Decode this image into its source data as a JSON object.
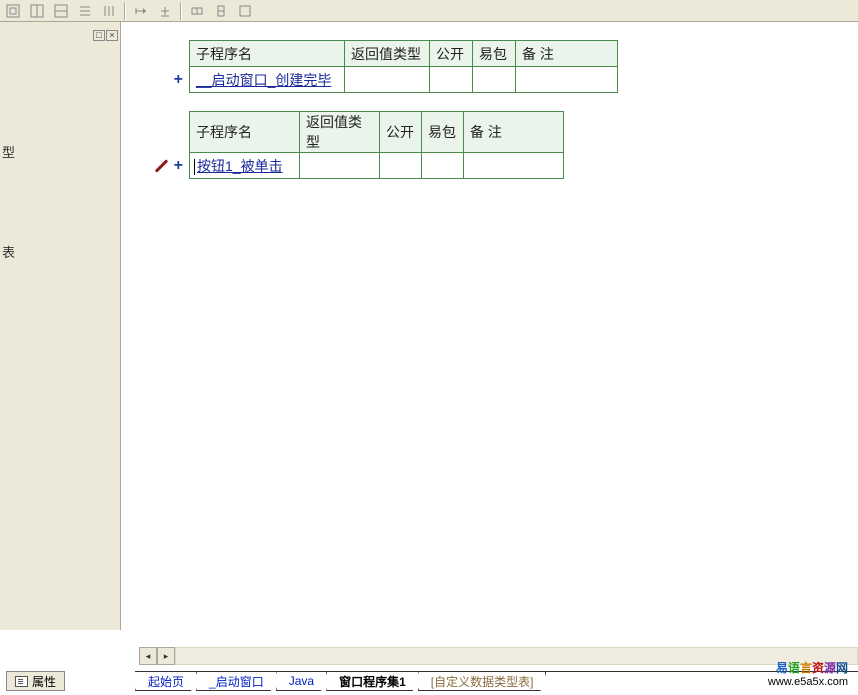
{
  "toolbar": {
    "buttons": [
      "□",
      "□",
      "□",
      "≡",
      "⊪",
      "⟼",
      "±",
      "⊟",
      "□",
      "□"
    ]
  },
  "left_panel": {
    "controls": [
      "□",
      "×"
    ],
    "hint1": "型",
    "hint2": "表"
  },
  "tables": [
    {
      "icons": [
        "plus"
      ],
      "headers": [
        "子程序名",
        "返回值类型",
        "公开",
        "易包",
        "备 注"
      ],
      "widths": [
        155,
        85,
        43,
        43,
        102
      ],
      "row": {
        "name": "__启动窗口_创建完毕",
        "cursor": false,
        "vals": [
          "",
          "",
          "",
          ""
        ]
      }
    },
    {
      "icons": [
        "pen",
        "plus"
      ],
      "headers": [
        "子程序名",
        "返回值类型",
        "公开",
        "易包",
        "备 注"
      ],
      "widths": [
        110,
        80,
        42,
        42,
        100
      ],
      "row": {
        "name": "按钮1_被单击",
        "cursor": true,
        "vals": [
          "",
          "",
          "",
          ""
        ]
      }
    }
  ],
  "tabs": {
    "property": "属性",
    "items": [
      {
        "label": "起始页",
        "style": "blue"
      },
      {
        "label": "_启动窗口",
        "style": "blue"
      },
      {
        "label": "Java",
        "style": "blue"
      },
      {
        "label": "窗口程序集1",
        "style": "active"
      },
      {
        "label": "[自定义数据类型表]",
        "style": "brown"
      }
    ]
  },
  "watermark": {
    "text": [
      "易",
      "语",
      "言",
      "资",
      "源",
      "网"
    ],
    "url": "www.e5a5x.com"
  }
}
